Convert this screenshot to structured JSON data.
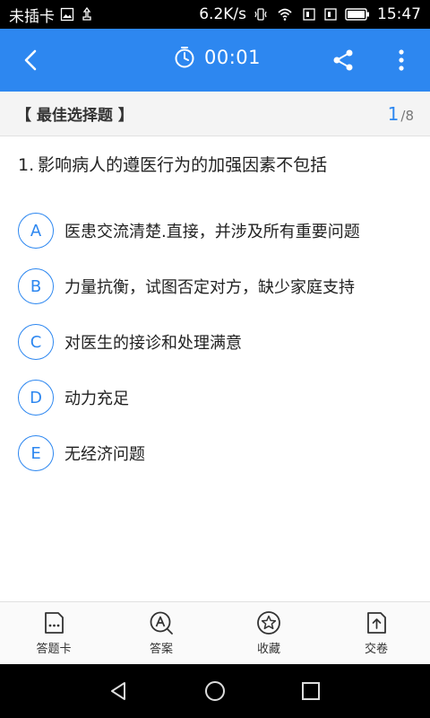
{
  "status_bar": {
    "carrier": "未插卡",
    "speed": "6.2K/s",
    "time": "15:47"
  },
  "header": {
    "timer": "00:01",
    "icons": [
      "back-icon",
      "timer-icon",
      "share-icon",
      "more-icon"
    ]
  },
  "question_type": {
    "label": "【 最佳选择题 】",
    "current": "1",
    "separator": "/",
    "total": "8"
  },
  "question": {
    "number": "1.",
    "text": "影响病人的遵医行为的加强因素不包括"
  },
  "options": [
    {
      "letter": "A",
      "text": "医患交流清楚.直接，并涉及所有重要问题"
    },
    {
      "letter": "B",
      "text": "力量抗衡，试图否定对方，缺少家庭支持"
    },
    {
      "letter": "C",
      "text": "对医生的接诊和处理满意"
    },
    {
      "letter": "D",
      "text": "动力充足"
    },
    {
      "letter": "E",
      "text": "无经济问题"
    }
  ],
  "bottom_tabs": [
    {
      "label": "答题卡",
      "icon": "answer-card-icon"
    },
    {
      "label": "答案",
      "icon": "answer-icon"
    },
    {
      "label": "收藏",
      "icon": "favorite-star-icon"
    },
    {
      "label": "交卷",
      "icon": "submit-icon"
    }
  ],
  "colors": {
    "accent": "#2d87f0",
    "header_bg": "#2d87f0",
    "type_bar_bg": "#f4f4f4"
  }
}
